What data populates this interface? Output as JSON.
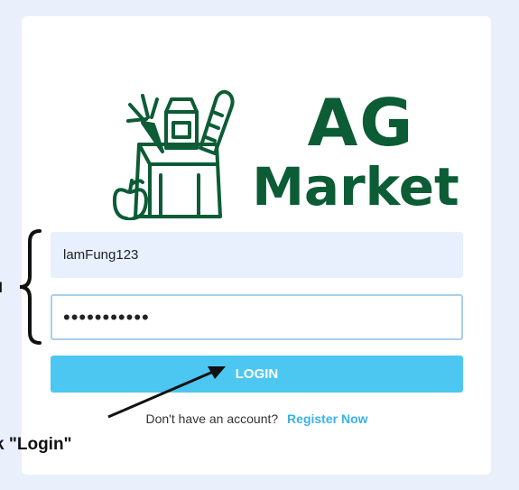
{
  "brand": {
    "line1": "AG",
    "line2": "Market",
    "color": "#0c5c36"
  },
  "login_form": {
    "username_value": "lamFung123",
    "password_value": "•••••••••••",
    "login_label": "LOGIN",
    "no_account_text": "Don't have an account?",
    "register_label": "Register Now"
  },
  "annotations": {
    "left_label": "il",
    "bottom_label": "k \"Login\""
  },
  "colors": {
    "background": "#e9f0fb",
    "button": "#4cc7f2",
    "link": "#3bb2e6"
  },
  "icons": {
    "logo": "grocery-bag-icon"
  }
}
